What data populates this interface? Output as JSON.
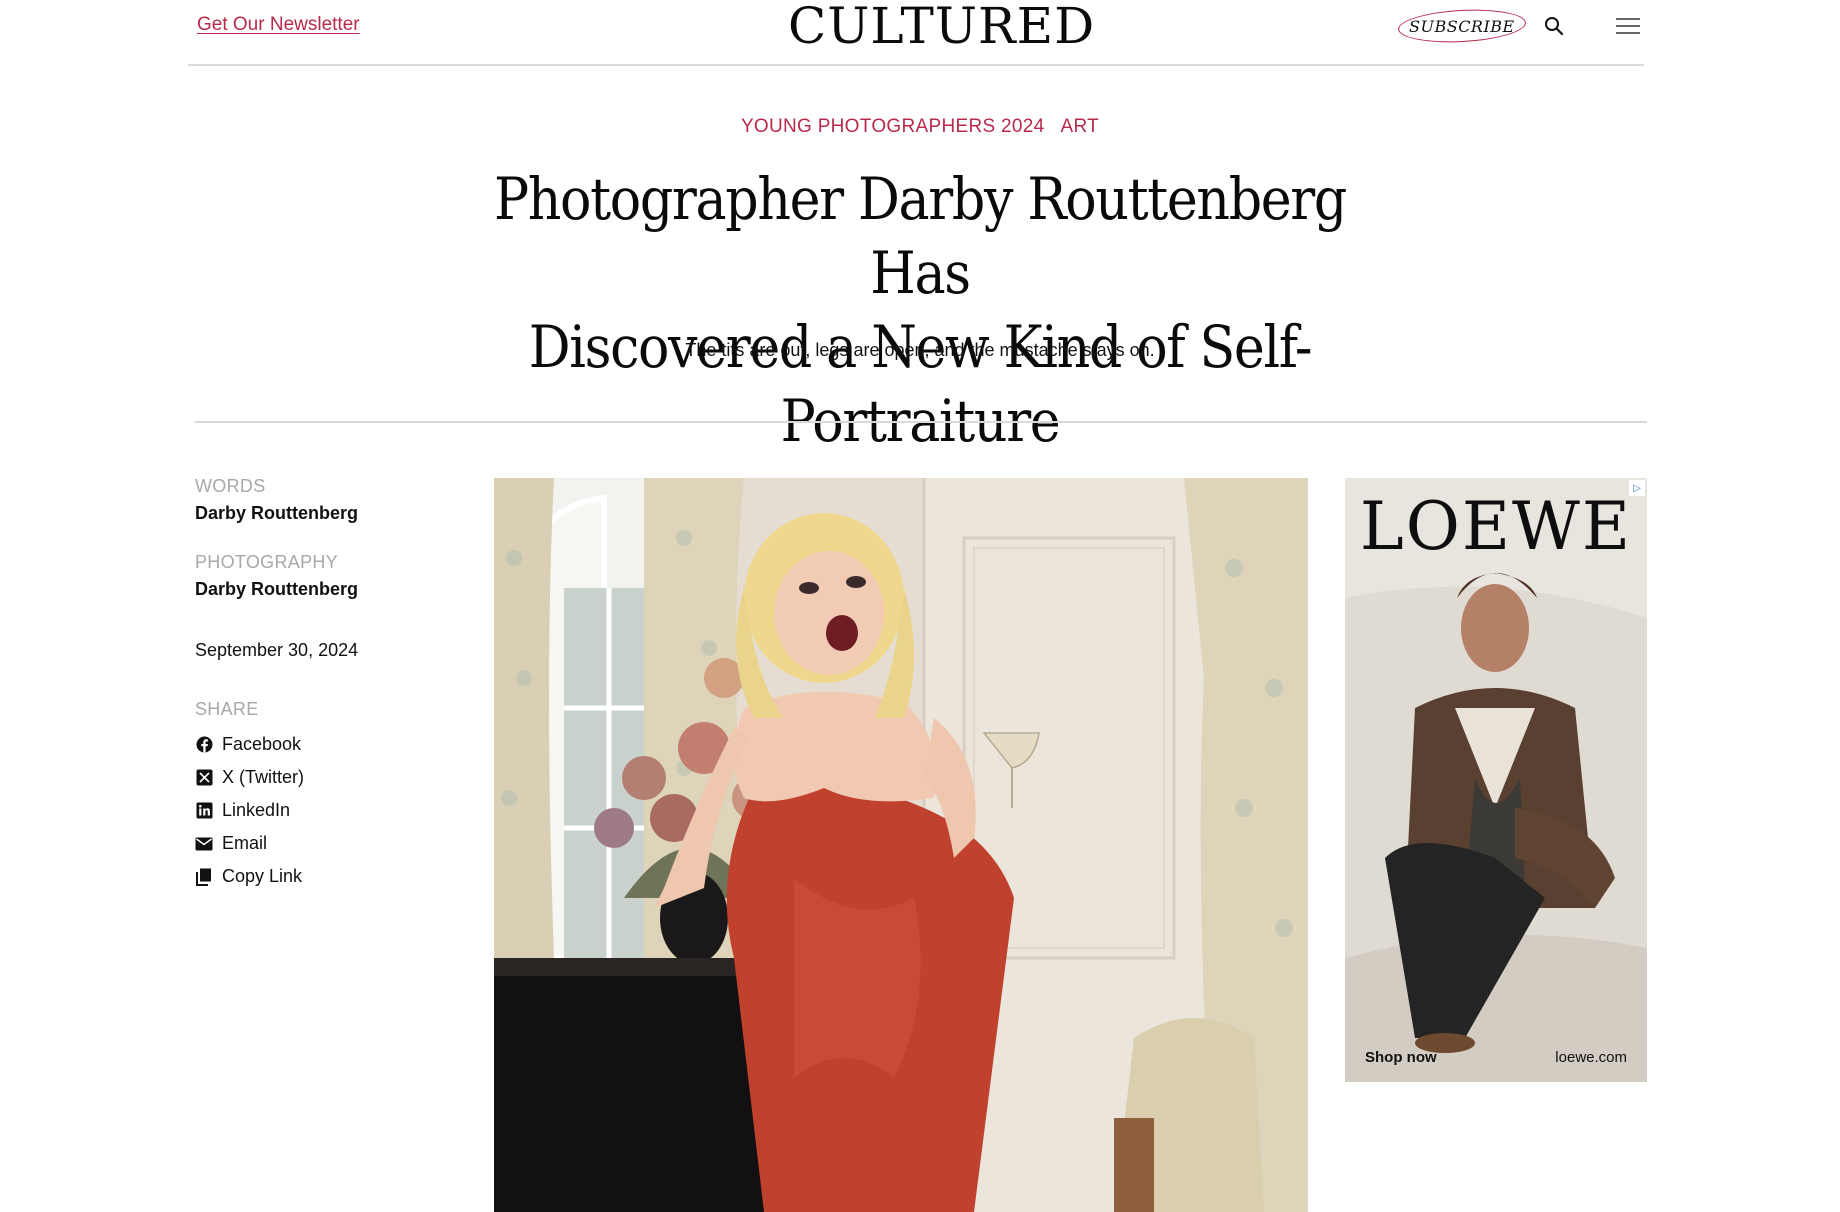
{
  "header": {
    "newsletter_label": "Get Our Newsletter",
    "logo_text": "CULTURED",
    "subscribe_label": "SUBSCRIBE",
    "search_icon": "search-icon",
    "menu_icon": "hamburger-menu-icon"
  },
  "article": {
    "kicker": [
      "YOUNG PHOTOGRAPHERS 2024",
      "ART"
    ],
    "headline_line1": "Photographer Darby Routtenberg Has",
    "headline_line2": "Discovered a New Kind of Self-Portraiture",
    "dek": "The tits are out, legs are open, and the mustache stays on."
  },
  "credits": {
    "words_label": "WORDS",
    "words_name": "Darby Routtenberg",
    "photo_label": "PHOTOGRAPHY",
    "photo_name": "Darby Routtenberg",
    "date": "September 30, 2024"
  },
  "share": {
    "label": "SHARE",
    "items": [
      {
        "label": "Facebook",
        "icon": "facebook-icon"
      },
      {
        "label": "X (Twitter)",
        "icon": "x-twitter-icon"
      },
      {
        "label": "LinkedIn",
        "icon": "linkedin-icon"
      },
      {
        "label": "Email",
        "icon": "email-icon"
      },
      {
        "label": "Copy Link",
        "icon": "copy-link-icon"
      }
    ]
  },
  "ad": {
    "brand": "LOEWE",
    "cta": "Shop now",
    "url": "loewe.com"
  },
  "colors": {
    "accent": "#b8294a",
    "muted": "#a8a8a8",
    "rule": "#d9d9d9"
  }
}
